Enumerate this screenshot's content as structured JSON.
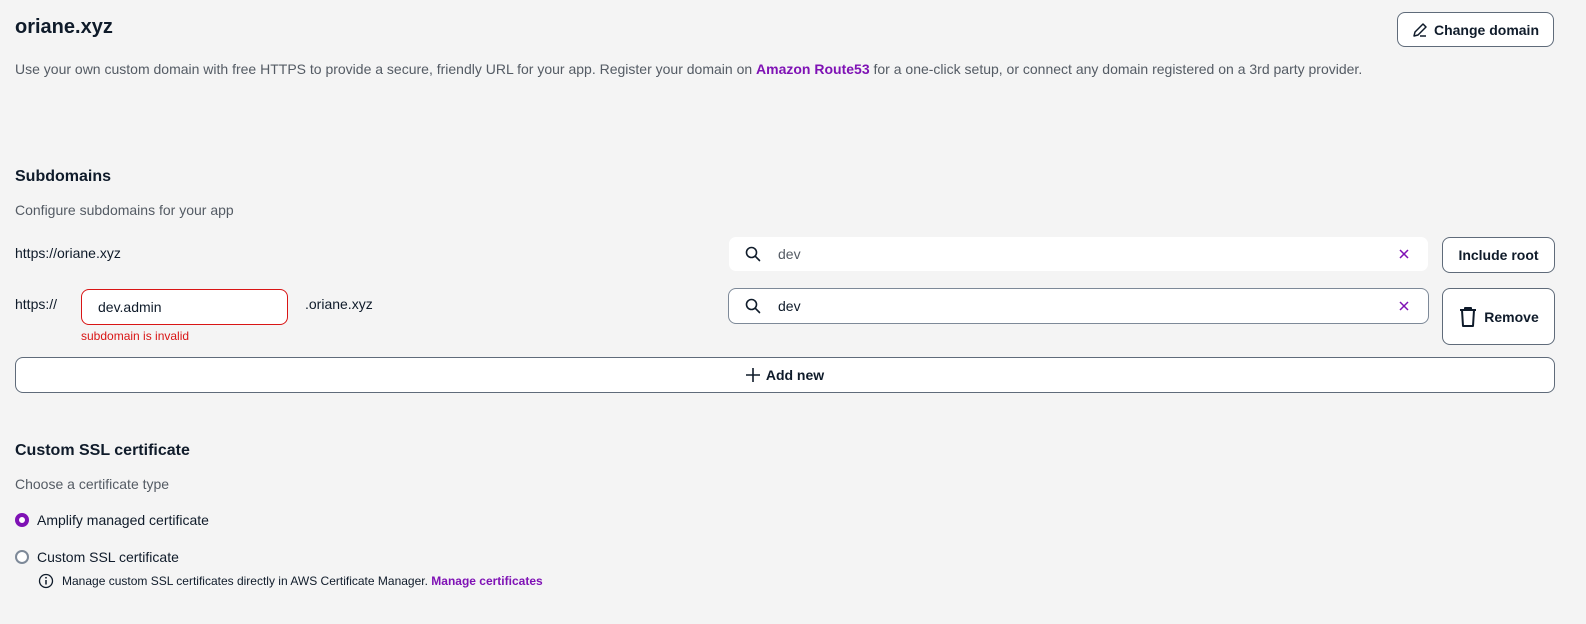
{
  "header": {
    "title": "oriane.xyz",
    "change_domain_label": "Change domain",
    "description_before": "Use your own custom domain with free HTTPS to provide a secure, friendly URL for your app. Register your domain on ",
    "description_link": "Amazon Route53",
    "description_after": " for a one-click setup, or connect any domain registered on a 3rd party provider."
  },
  "subdomains": {
    "title": "Subdomains",
    "description": "Configure subdomains for your app",
    "root_url": "https://oriane.xyz",
    "rows": [
      {
        "branch_value": "dev",
        "action_label": "Include root"
      },
      {
        "prefix": "https://",
        "subdomain_value": "dev.admin",
        "error": "subdomain is invalid",
        "suffix": ".oriane.xyz",
        "branch_value": "dev",
        "action_label": "Remove"
      }
    ],
    "add_new_label": "Add new"
  },
  "ssl": {
    "title": "Custom SSL certificate",
    "description": "Choose a certificate type",
    "options": [
      {
        "label": "Amplify managed certificate",
        "selected": true
      },
      {
        "label": "Custom SSL certificate",
        "selected": false
      }
    ],
    "info_text": "Manage custom SSL certificates directly in AWS Certificate Manager.",
    "info_link": "Manage certificates"
  },
  "colors": {
    "accent": "#7f12b5",
    "error": "#d91515",
    "background": "#f4f4f4",
    "muted_text": "#545b64"
  },
  "icons": [
    "edit-icon",
    "search-icon",
    "clear-icon",
    "trash-icon",
    "plus-icon",
    "info-icon"
  ]
}
